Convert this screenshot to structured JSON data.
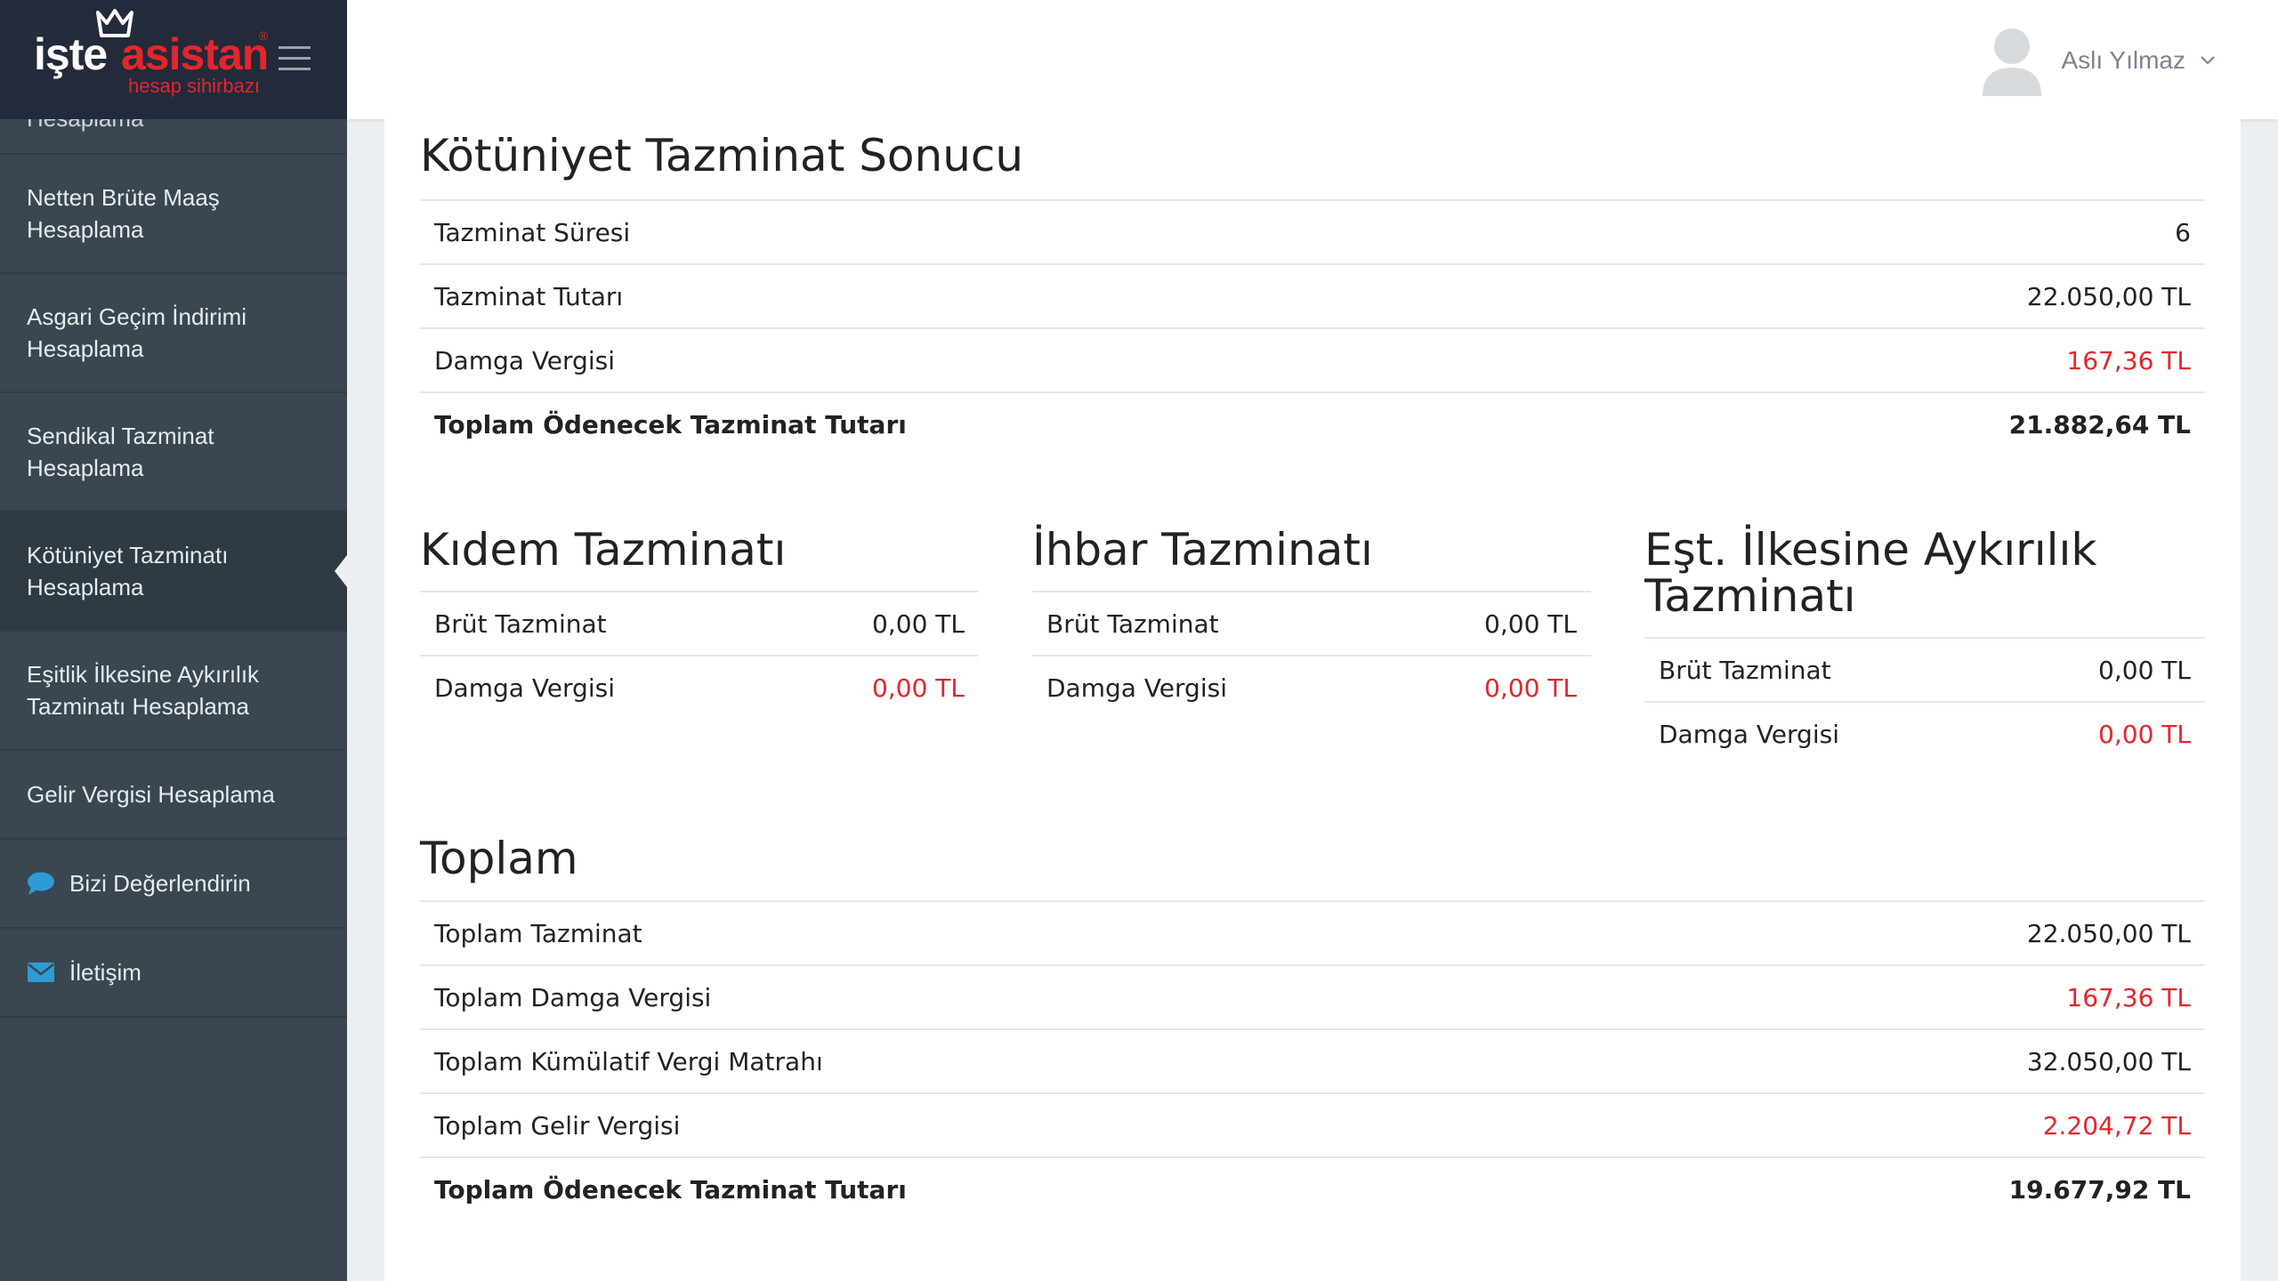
{
  "brand": {
    "name_part1": "işte",
    "name_part2": "asistan",
    "registered": "®",
    "tagline": "hesap sihirbazı"
  },
  "sidebar": {
    "partial_item": "Hesaplama",
    "items": [
      {
        "label": "Netten Brüte Maaş Hesaplama",
        "active": false
      },
      {
        "label": "Asgari Geçim İndirimi Hesaplama",
        "active": false
      },
      {
        "label": "Sendikal Tazminat Hesaplama",
        "active": false
      },
      {
        "label": "Kötüniyet Tazminatı Hesaplama",
        "active": true
      },
      {
        "label": "Eşitlik İlkesine Aykırılık Tazminatı Hesaplama",
        "active": false
      },
      {
        "label": "Gelir Vergisi Hesaplama",
        "active": false
      },
      {
        "label": "Bizi Değerlendirin",
        "icon": "chat-bubble-icon"
      },
      {
        "label": "İletişim",
        "icon": "envelope-icon"
      }
    ]
  },
  "header": {
    "user_name": "Aslı Yılmaz"
  },
  "result": {
    "title": "Kötüniyet Tazminat Sonucu",
    "rows": [
      {
        "label": "Tazminat Süresi",
        "value": "6"
      },
      {
        "label": "Tazminat Tutarı",
        "value": "22.050,00 TL"
      },
      {
        "label": "Damga Vergisi",
        "value": "167,36 TL"
      },
      {
        "label": "Toplam Ödenecek Tazminat Tutarı",
        "value": "21.882,64 TL"
      }
    ]
  },
  "kidem": {
    "title": "Kıdem Tazminatı",
    "rows": [
      {
        "label": "Brüt Tazminat",
        "value": "0,00 TL"
      },
      {
        "label": "Damga Vergisi",
        "value": "0,00 TL"
      }
    ]
  },
  "ihbar": {
    "title": "İhbar Tazminatı",
    "rows": [
      {
        "label": "Brüt Tazminat",
        "value": "0,00 TL"
      },
      {
        "label": "Damga Vergisi",
        "value": "0,00 TL"
      }
    ]
  },
  "esitlik": {
    "title_line1": "Eşt. İlkesine Aykırılık",
    "title_line2": "Tazminatı",
    "rows": [
      {
        "label": "Brüt Tazminat",
        "value": "0,00 TL"
      },
      {
        "label": "Damga Vergisi",
        "value": "0,00 TL"
      }
    ]
  },
  "total": {
    "title": "Toplam",
    "rows": [
      {
        "label": "Toplam Tazminat",
        "value": "22.050,00 TL"
      },
      {
        "label": "Toplam Damga Vergisi",
        "value": "167,36 TL"
      },
      {
        "label": "Toplam Kümülatif Vergi Matrahı",
        "value": "32.050,00 TL"
      },
      {
        "label": "Toplam Gelir Vergisi",
        "value": "2.204,72 TL"
      },
      {
        "label": "Toplam Ödenecek Tazminat Tutarı",
        "value": "19.677,92 TL"
      }
    ]
  },
  "colors": {
    "sidebar_bg": "#3a4650",
    "logo_bg": "#232a3a",
    "brand_red": "#e3262b",
    "negative_value": "#e3262b",
    "icon_blue": "#2f9bd6"
  }
}
